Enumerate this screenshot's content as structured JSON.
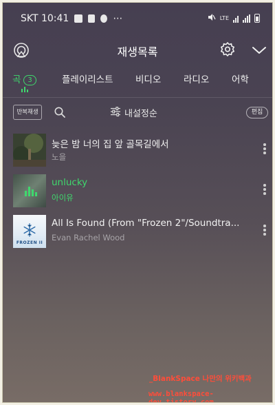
{
  "status_bar": {
    "carrier_time": "SKT 10:41",
    "dots": "⋯",
    "lte": "LTE"
  },
  "header": {
    "title": "재생목록",
    "left_icon": "cast-icon",
    "gear_icon": "gear-icon",
    "chevron_icon": "chevron-down-icon"
  },
  "tabs": [
    {
      "label": "곡",
      "badge": "3",
      "active": true
    },
    {
      "label": "플레이리스트",
      "active": false
    },
    {
      "label": "비디오",
      "active": false
    },
    {
      "label": "라디오",
      "active": false
    },
    {
      "label": "어학",
      "active": false
    }
  ],
  "toolbar": {
    "repeat_label": "반복재생",
    "sort_label": "내설정순",
    "edit_label": "편집"
  },
  "tracks": [
    {
      "title": "늦은 밤 너의 집 앞 골목길에서",
      "artist": "노을",
      "playing": false
    },
    {
      "title": "unlucky",
      "artist": "아이유",
      "playing": true
    },
    {
      "title": "All Is Found (From \"Frozen 2\"/Soundtra...",
      "artist": "Evan Rachel Wood",
      "playing": false,
      "album_label": "FROZEN II"
    }
  ],
  "watermark": {
    "line1": "_BlankSpace 나만의 위키백과",
    "line2": "www.blankspace-dev.tistory.com"
  },
  "colors": {
    "accent": "#3fd86d",
    "watermark": "#ff4d3a"
  }
}
